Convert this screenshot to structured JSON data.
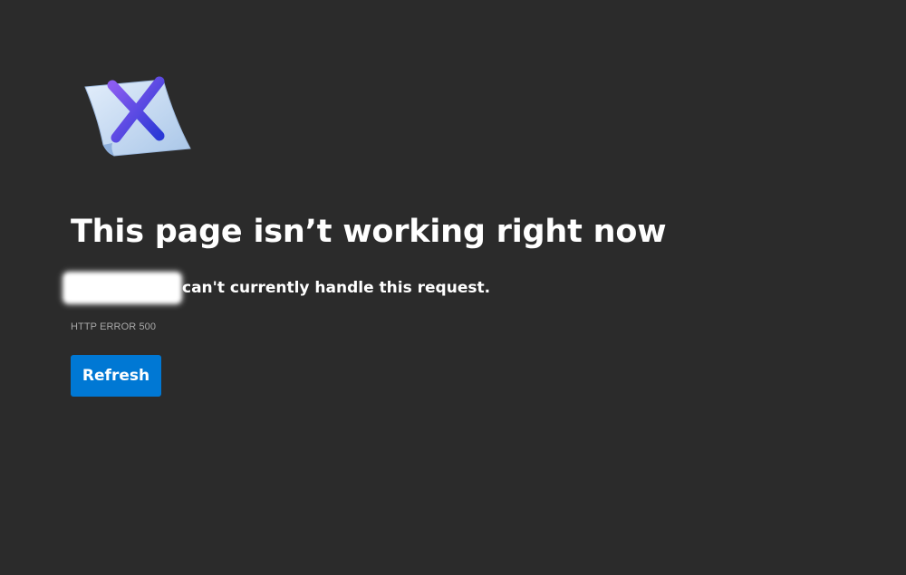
{
  "error_page": {
    "title": "This page isn’t working right now",
    "host": "",
    "message": "can't currently handle this request.",
    "error_code": "HTTP ERROR 500",
    "refresh_label": "Refresh",
    "icon": "document-x-icon"
  },
  "colors": {
    "background": "#2b2b2b",
    "button": "#0078d4",
    "text": "#ffffff",
    "muted_text": "#a8a8a8",
    "icon_x_start": "#7a4fe0",
    "icon_x_end": "#2f3fd8",
    "icon_paper": "#c9ddf2"
  }
}
